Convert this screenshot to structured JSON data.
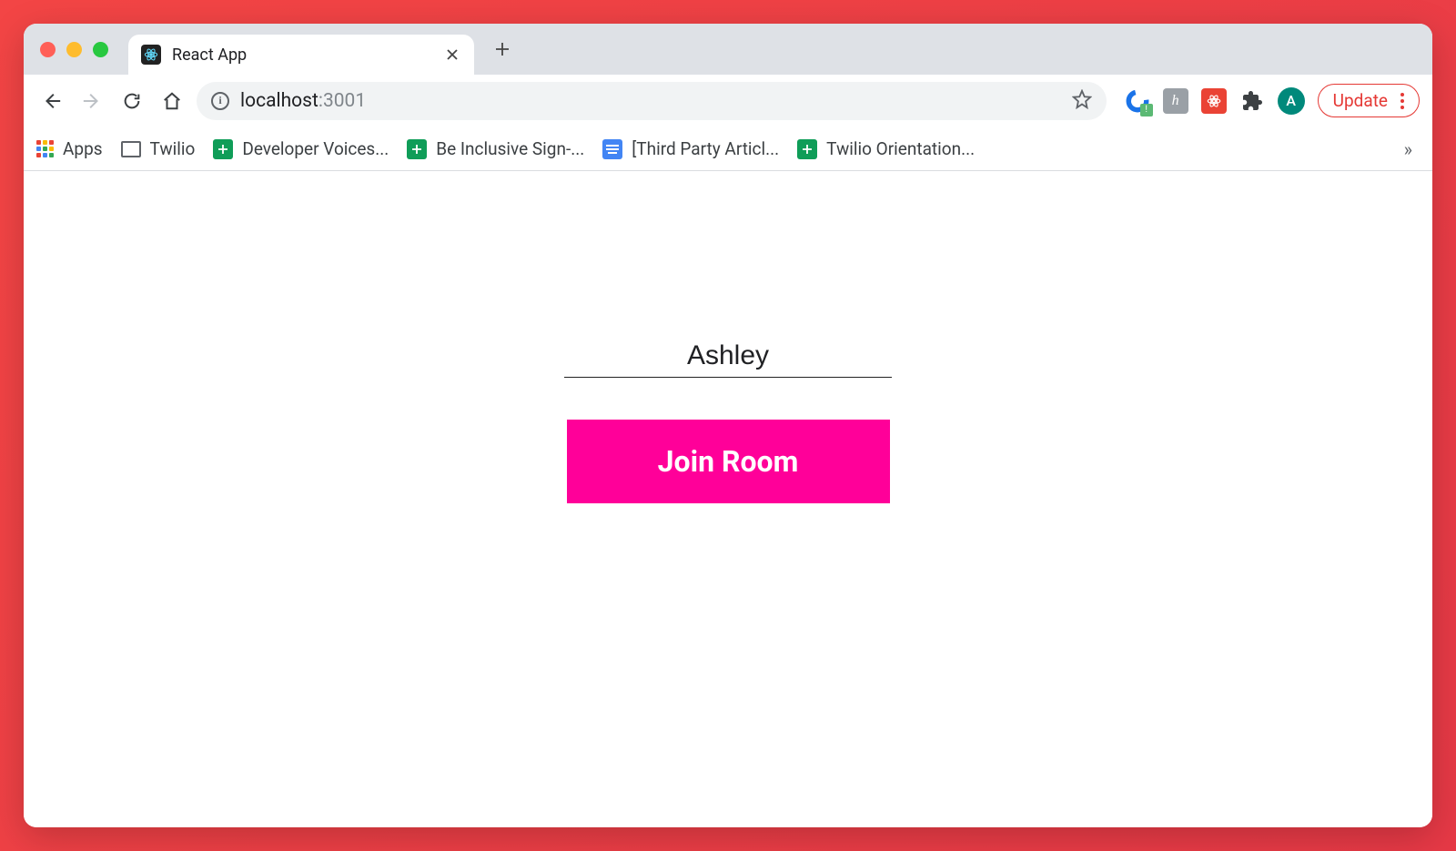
{
  "browser": {
    "tab": {
      "title": "React App"
    },
    "address": {
      "host": "localhost",
      "port": ":3001"
    },
    "update_label": "Update",
    "avatar_initial": "A",
    "bookmarks": [
      {
        "label": "Apps"
      },
      {
        "label": "Twilio"
      },
      {
        "label": "Developer Voices..."
      },
      {
        "label": "Be Inclusive Sign-..."
      },
      {
        "label": "[Third Party Articl..."
      },
      {
        "label": "Twilio Orientation..."
      }
    ]
  },
  "page": {
    "name_value": "Ashley",
    "join_label": "Join Room"
  },
  "colors": {
    "accent": "#ff0099",
    "frame": "#e63946"
  }
}
